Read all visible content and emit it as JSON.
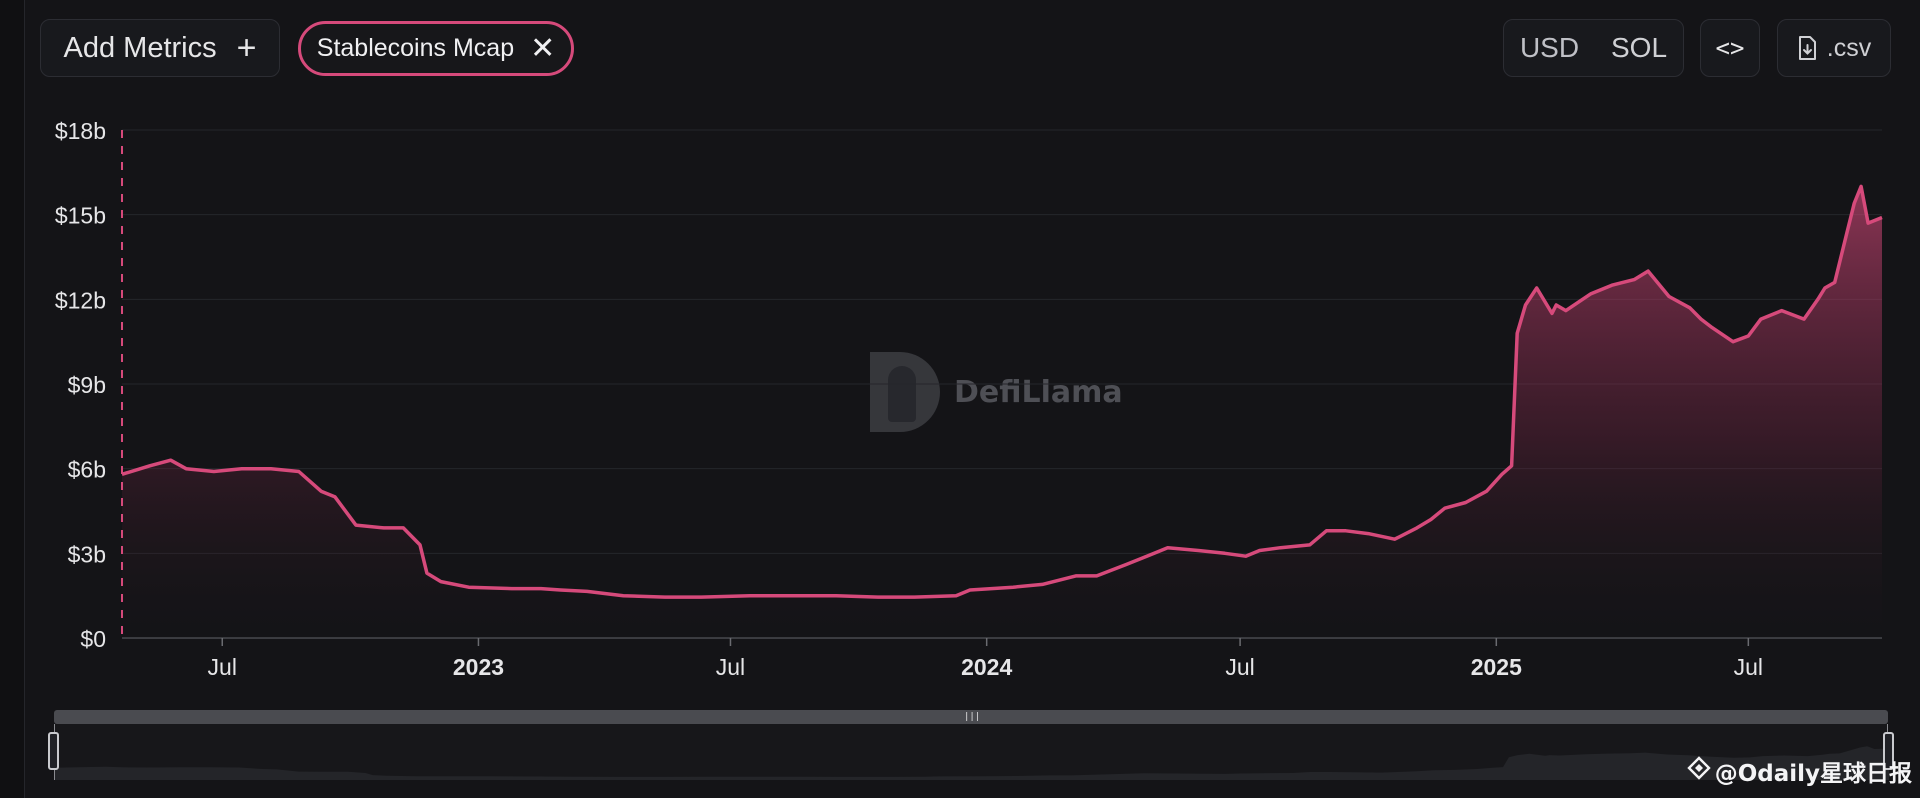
{
  "toolbar": {
    "add_metrics_label": "Add Metrics",
    "add_metrics_icon": "plus-icon",
    "metric_chip_label": "Stablecoins Mcap",
    "metric_chip_icon": "close-icon",
    "currency_options": [
      "USD",
      "SOL"
    ],
    "currency_selected": "USD",
    "embed_label": "<>",
    "embed_icon": "code-icon",
    "csv_label": ".csv",
    "csv_icon": "download-file-icon"
  },
  "watermark": {
    "brand": "DefiLlama",
    "logo_icon": "llama-logo-icon"
  },
  "credit": {
    "text": "@Odaily星球日报",
    "icon": "binance-square-icon"
  },
  "colors": {
    "background": "#141417",
    "series_line": "#d64a7b",
    "grid": "#25262b",
    "axis_text": "#e6e6e8"
  },
  "chart_data": {
    "type": "area",
    "title": "",
    "xlabel": "",
    "ylabel": "",
    "x_type": "date",
    "xlim": [
      "2022-04-20",
      "2025-10-05"
    ],
    "ylim": [
      0,
      18
    ],
    "y_unit": "billion USD",
    "yticks": [
      0,
      3,
      6,
      9,
      12,
      15,
      18
    ],
    "ytick_labels": [
      "$0",
      "$3b",
      "$6b",
      "$9b",
      "$12b",
      "$15b",
      "$18b"
    ],
    "xticks": [
      {
        "date": "2022-07-01",
        "label": "Jul",
        "bold": false
      },
      {
        "date": "2023-01-01",
        "label": "2023",
        "bold": true
      },
      {
        "date": "2023-07-01",
        "label": "Jul",
        "bold": false
      },
      {
        "date": "2024-01-01",
        "label": "2024",
        "bold": true
      },
      {
        "date": "2024-07-01",
        "label": "Jul",
        "bold": false
      },
      {
        "date": "2025-01-01",
        "label": "2025",
        "bold": true
      },
      {
        "date": "2025-07-01",
        "label": "Jul",
        "bold": false
      }
    ],
    "grid": true,
    "legend": "none",
    "series": [
      {
        "name": "Stablecoins Mcap",
        "x": [
          "2022-04-20",
          "2022-05-10",
          "2022-05-25",
          "2022-06-05",
          "2022-06-25",
          "2022-07-15",
          "2022-08-05",
          "2022-08-25",
          "2022-09-10",
          "2022-09-20",
          "2022-10-05",
          "2022-10-25",
          "2022-11-08",
          "2022-11-20",
          "2022-11-25",
          "2022-12-05",
          "2022-12-25",
          "2023-01-25",
          "2023-02-15",
          "2023-03-01",
          "2023-03-20",
          "2023-04-15",
          "2023-05-15",
          "2023-06-10",
          "2023-07-15",
          "2023-08-10",
          "2023-09-15",
          "2023-10-15",
          "2023-11-10",
          "2023-12-10",
          "2023-12-20",
          "2024-01-20",
          "2024-02-10",
          "2024-03-05",
          "2024-03-20",
          "2024-04-10",
          "2024-04-25",
          "2024-05-10",
          "2024-06-01",
          "2024-06-20",
          "2024-07-05",
          "2024-07-15",
          "2024-07-30",
          "2024-08-20",
          "2024-09-01",
          "2024-09-15",
          "2024-10-01",
          "2024-10-20",
          "2024-11-05",
          "2024-11-15",
          "2024-11-25",
          "2024-12-10",
          "2024-12-25",
          "2025-01-05",
          "2025-01-12",
          "2025-01-16",
          "2025-01-22",
          "2025-01-30",
          "2025-02-10",
          "2025-02-13",
          "2025-02-20",
          "2025-03-10",
          "2025-03-25",
          "2025-04-10",
          "2025-04-20",
          "2025-05-05",
          "2025-05-20",
          "2025-05-28",
          "2025-06-05",
          "2025-06-20",
          "2025-07-01",
          "2025-07-10",
          "2025-07-25",
          "2025-08-10",
          "2025-08-20",
          "2025-08-25",
          "2025-09-01",
          "2025-09-10",
          "2025-09-15",
          "2025-09-20",
          "2025-09-25",
          "2025-10-05"
        ],
        "y": [
          5.8,
          6.1,
          6.3,
          6.0,
          5.9,
          6.0,
          6.0,
          5.9,
          5.2,
          5.0,
          4.0,
          3.9,
          3.9,
          3.3,
          2.3,
          2.0,
          1.8,
          1.75,
          1.75,
          1.7,
          1.65,
          1.5,
          1.45,
          1.45,
          1.5,
          1.5,
          1.5,
          1.45,
          1.45,
          1.5,
          1.7,
          1.8,
          1.9,
          2.2,
          2.2,
          2.6,
          2.9,
          3.2,
          3.1,
          3.0,
          2.9,
          3.1,
          3.2,
          3.3,
          3.8,
          3.8,
          3.7,
          3.5,
          3.9,
          4.2,
          4.6,
          4.8,
          5.2,
          5.8,
          6.1,
          10.8,
          11.8,
          12.4,
          11.5,
          11.8,
          11.6,
          12.2,
          12.5,
          12.7,
          13.0,
          12.1,
          11.7,
          11.3,
          11.0,
          10.5,
          10.7,
          11.3,
          11.6,
          11.3,
          12.0,
          12.4,
          12.6,
          14.4,
          15.4,
          16.0,
          14.7,
          14.9
        ]
      }
    ]
  }
}
